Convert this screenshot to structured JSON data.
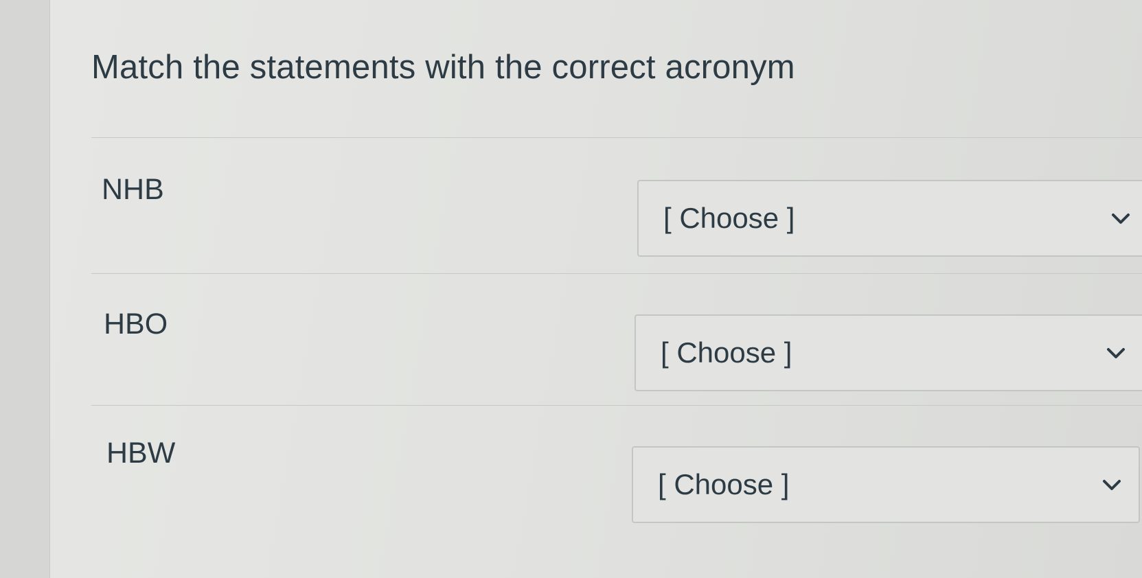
{
  "question": {
    "title": "Match the statements with the correct acronym"
  },
  "rows": [
    {
      "label": "NHB",
      "selected": "[ Choose ]"
    },
    {
      "label": "HBO",
      "selected": "[ Choose ]"
    },
    {
      "label": "HBW",
      "selected": "[ Choose ]"
    }
  ],
  "colors": {
    "text": "#2d3b45",
    "border": "#c4c6c3",
    "background": "#e3e4e1"
  },
  "icons": {
    "dropdown": "chevron-down-icon"
  }
}
